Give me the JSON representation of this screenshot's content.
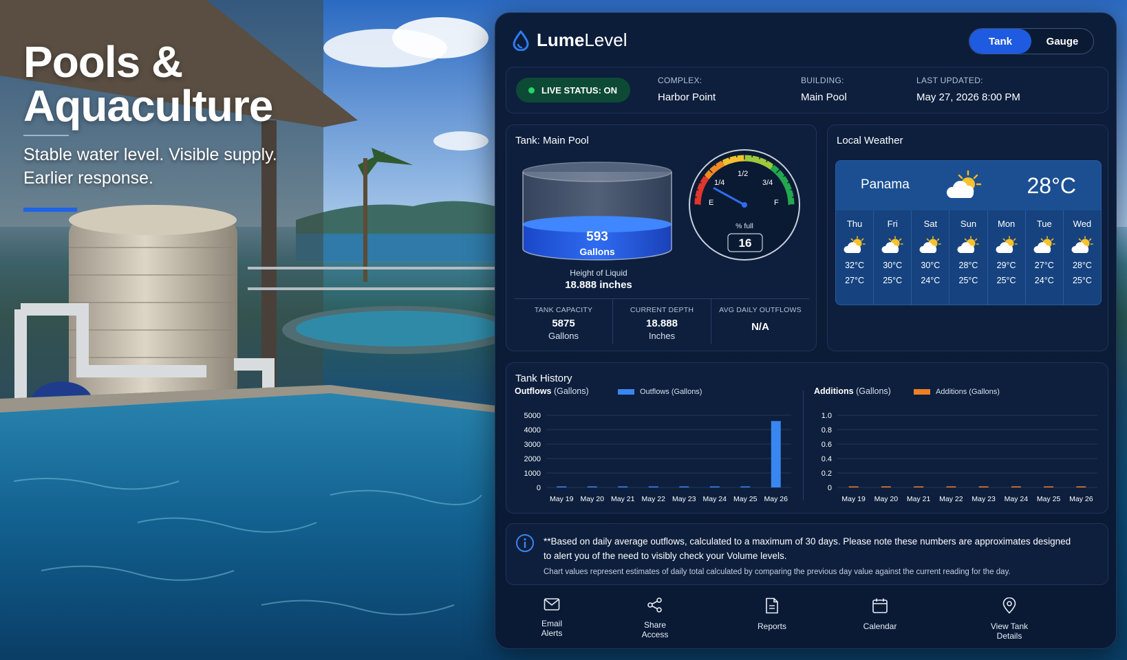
{
  "hero": {
    "title_line1": "Pools &",
    "title_line2": "Aquaculture",
    "subtitle_line1": "Stable water level. Visible supply.",
    "subtitle_line2": "Earlier response."
  },
  "brand": {
    "name_bold": "Lume",
    "name_light": "Level"
  },
  "view_toggle": {
    "options": [
      "Tank",
      "Gauge"
    ],
    "active": "Tank"
  },
  "status": {
    "live_label": "LIVE STATUS: ON",
    "complex_key": "COMPLEX:",
    "complex_value": "Harbor Point",
    "building_key": "BUILDING:",
    "building_value": "Main Pool",
    "updated_key": "LAST UPDATED:",
    "updated_value": "May 27, 2026 8:00 PM"
  },
  "tank": {
    "title": "Tank: Main Pool",
    "volume_value": "593",
    "volume_unit": "Gallons",
    "fill_fraction": 0.1,
    "height_label": "Height of Liquid",
    "height_value": "18.888 inches",
    "gauge": {
      "labels": [
        "E",
        "1/4",
        "1/2",
        "3/4",
        "F"
      ],
      "pct_label": "% full",
      "pct_value": "16",
      "pct_numeric": 16
    },
    "stats": [
      {
        "key": "TANK CAPACITY",
        "value": "5875",
        "unit": "Gallons"
      },
      {
        "key": "CURRENT DEPTH",
        "value": "18.888",
        "unit": "Inches"
      },
      {
        "key": "AVG DAILY OUTFLOWS",
        "value": "N/A"
      }
    ]
  },
  "weather": {
    "title": "Local Weather",
    "city": "Panama",
    "current_temp": "28°C",
    "current_icon": "partly-cloudy-icon",
    "days": [
      {
        "day": "Thu",
        "hi": "32°C",
        "lo": "27°C",
        "icon": "partly-cloudy-icon"
      },
      {
        "day": "Fri",
        "hi": "30°C",
        "lo": "25°C",
        "icon": "partly-cloudy-icon"
      },
      {
        "day": "Sat",
        "hi": "30°C",
        "lo": "24°C",
        "icon": "partly-cloudy-icon"
      },
      {
        "day": "Sun",
        "hi": "28°C",
        "lo": "25°C",
        "icon": "partly-cloudy-icon"
      },
      {
        "day": "Mon",
        "hi": "29°C",
        "lo": "25°C",
        "icon": "partly-cloudy-icon"
      },
      {
        "day": "Tue",
        "hi": "27°C",
        "lo": "24°C",
        "icon": "partly-cloudy-icon"
      },
      {
        "day": "Wed",
        "hi": "28°C",
        "lo": "25°C",
        "icon": "partly-cloudy-icon"
      }
    ]
  },
  "history": {
    "title": "Tank History",
    "outflows": {
      "title_bold": "Outflows",
      "title_unit": "(Gallons)",
      "legend": "Outflows (Gallons)",
      "color": "#3a86f0"
    },
    "additions": {
      "title_bold": "Additions",
      "title_unit": "(Gallons)",
      "legend": "Additions (Gallons)",
      "color": "#f07f24"
    }
  },
  "chart_data": [
    {
      "type": "bar",
      "title": "Outflows (Gallons)",
      "categories": [
        "May 19",
        "May 20",
        "May 21",
        "May 22",
        "May 23",
        "May 24",
        "May 25",
        "May 26"
      ],
      "series": [
        {
          "name": "Outflows (Gallons)",
          "values": [
            60,
            40,
            30,
            30,
            30,
            30,
            40,
            4600
          ]
        }
      ],
      "yticks": [
        0,
        1000,
        2000,
        3000,
        4000,
        5000
      ],
      "ylim": [
        0,
        5000
      ],
      "grid": true,
      "legend": "top"
    },
    {
      "type": "bar",
      "title": "Additions (Gallons)",
      "categories": [
        "May 19",
        "May 20",
        "May 21",
        "May 22",
        "May 23",
        "May 24",
        "May 25",
        "May 26"
      ],
      "series": [
        {
          "name": "Additions (Gallons)",
          "values": [
            0.01,
            0.01,
            0.01,
            0.01,
            0.01,
            0.01,
            0.01,
            0.01
          ]
        }
      ],
      "yticks": [
        "0",
        "0.2",
        "0.4",
        "0.6",
        "0.8",
        "1.0"
      ],
      "ylim": [
        0,
        1
      ],
      "grid": true,
      "legend": "top"
    }
  ],
  "note": {
    "main": "**Based on daily average outflows, calculated to a maximum of 30 days. Please note these numbers are approximates designed to alert you of the need to visibly check your Volume levels.",
    "sub": "Chart values represent estimates of daily total calculated by comparing the previous day value against the current reading for the day."
  },
  "footer": [
    {
      "line1": "Email",
      "line2": "Alerts",
      "icon": "envelope-icon"
    },
    {
      "line1": "Share",
      "line2": "Access",
      "icon": "share-icon"
    },
    {
      "line1": "Reports",
      "line2": "",
      "icon": "document-icon"
    },
    {
      "line1": "Calendar",
      "line2": "",
      "icon": "calendar-icon"
    },
    {
      "line1": "View Tank",
      "line2": "Details",
      "icon": "location-pin-icon"
    }
  ]
}
